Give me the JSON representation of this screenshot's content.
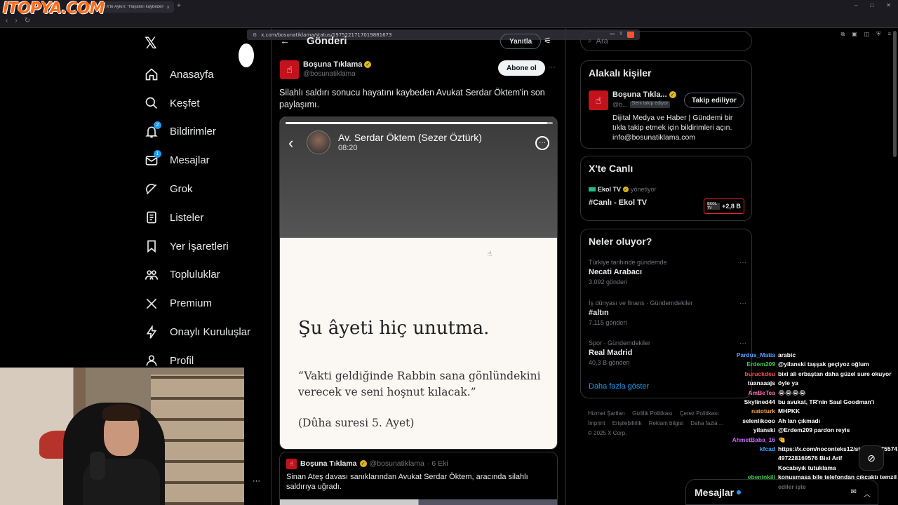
{
  "browser": {
    "watermark": "ITOPYA.COM",
    "tab_title": "(3) X'te Aykırı: \"Hayatını kaybeden Av...",
    "url": "x.com/bosunatiklama/status/1975221717019881673"
  },
  "nav": {
    "items": [
      {
        "label": "Anasayfa",
        "icon": "home-icon"
      },
      {
        "label": "Keşfet",
        "icon": "search-icon"
      },
      {
        "label": "Bildirimler",
        "icon": "bell-icon",
        "badge": "2"
      },
      {
        "label": "Mesajlar",
        "icon": "mail-icon",
        "badge": "1"
      },
      {
        "label": "Grok",
        "icon": "grok-icon"
      },
      {
        "label": "Listeler",
        "icon": "list-icon"
      },
      {
        "label": "Yer İşaretleri",
        "icon": "bookmark-icon"
      },
      {
        "label": "Topluluklar",
        "icon": "communities-icon"
      },
      {
        "label": "Premium",
        "icon": "x-icon"
      },
      {
        "label": "Onaylı Kuruluşlar",
        "icon": "lightning-icon"
      },
      {
        "label": "Profil",
        "icon": "user-icon"
      }
    ]
  },
  "post": {
    "header_title": "Gönderi",
    "reply_label": "Yanıtla",
    "author_name": "Boşuna Tıklama",
    "author_handle": "@bosunatiklama",
    "follow_label": "Abone ol",
    "text": "Silahlı saldırı sonucu hayatını kaybeden Avukat Serdar Öktem'in son paylaşımı.",
    "story": {
      "name": "Av. Serdar Öktem (Sezer Öztürk)",
      "time": "08:20",
      "progress": 0.98,
      "verse_title": "Şu âyeti hiç unutma.",
      "verse_body": "“Vakti geldiğinde Rabbin sana gönlündekini verecek ve seni hoşnut kılacak.”",
      "verse_ref": "(Dûha suresi 5. Ayet)"
    },
    "quote": {
      "author_name": "Boşuna Tıklama",
      "author_handle": "@bosunatiklama",
      "date": "· 6 Eki",
      "text": "Sinan Ateş davası sanıklarından Avukat Serdar Öktem, aracında silahlı saldırıya uğradı."
    }
  },
  "sidebar": {
    "search_placeholder": "Ara",
    "related": {
      "title": "Alakalı kişiler",
      "name": "Boşuna Tıkla...",
      "handle": "@b...",
      "follows_you": "Seni takip ediyor",
      "following_label": "Takip ediliyor",
      "bio": "Dijital Medya ve Haber | Gündemi bir tıkla takip etmek için bildirimleri açın. info@bosunatiklama.com"
    },
    "live": {
      "title": "X'te Canlı",
      "host": "Ekol TV",
      "role": "yönetiyor",
      "stream_title": "#Canlı - Ekol TV",
      "mini_label": "EKOL TV",
      "viewers": "+2,8 B"
    },
    "trends": {
      "title": "Neler oluyor?",
      "items": [
        {
          "meta": "Türkiye tarihinde gündemde",
          "name": "Necati Arabacı",
          "count": "3.092 gönderi"
        },
        {
          "meta": "İş dünyası ve finans · Gündemdekiler",
          "name": "#altın",
          "count": "7.115 gönderi"
        },
        {
          "meta": "Spor · Gündemdekiler",
          "name": "Real Madrid",
          "count": "40,3 B gönderi"
        }
      ],
      "show_more": "Daha fazla göster"
    },
    "footer": {
      "links": [
        "Hizmet Şartları",
        "Gizlilik Politikası",
        "Çerez Politikası",
        "İmprint",
        "Erişilebilirlik",
        "Reklam bilgisi",
        "Daha fazla ..."
      ],
      "copyright": "© 2025 X Corp."
    }
  },
  "chat": {
    "messages": [
      {
        "user": "Pardus_Matia",
        "color": "#5aa0ff",
        "text": "arabic"
      },
      {
        "user": "Erdem209",
        "color": "#3ecb4e",
        "text": "@yilanski taşşak geçiyoz oğlum"
      },
      {
        "user": "buruckdeu",
        "color": "#ff4a4a",
        "text": "bixi ali erbaştan daha güzel sure okuyor"
      },
      {
        "user": "tuanaaajs",
        "color": "#ffffff",
        "text": "öyle ya"
      },
      {
        "user": "AmBeTea",
        "color": "#ff6bb0",
        "text": "😭😭😭😭"
      },
      {
        "user": "Skylined44",
        "color": "#ffffff",
        "text": "bu avukat, TR'nin Saul Goodman'i"
      },
      {
        "user": "natoturk",
        "color": "#ffa94d",
        "text": "MHPKK"
      },
      {
        "user": "selenlikooo",
        "color": "#ffffff",
        "text": "Ah lan çıkmadı"
      },
      {
        "user": "yilanski",
        "color": "#ffffff",
        "text": "@Erdem209 pardon reyis"
      },
      {
        "user": "AhmetBaba_16",
        "color": "#c56bff",
        "text": "🤏"
      },
      {
        "user": "kfcad",
        "color": "#3fa9ff",
        "text": "https://x.com/noconteks12/status/1975574497228169576 Bixi Arif"
      },
      {
        "user": "",
        "color": "#ffffff",
        "text": "Kocabıyık tutuklama"
      },
      {
        "user": "ebeninkili",
        "color": "#3ecb4e",
        "text": "konuşmasa bile telefondan çıkcaktı temzilediler işte"
      }
    ]
  },
  "dm": {
    "label": "Mesajlar"
  }
}
